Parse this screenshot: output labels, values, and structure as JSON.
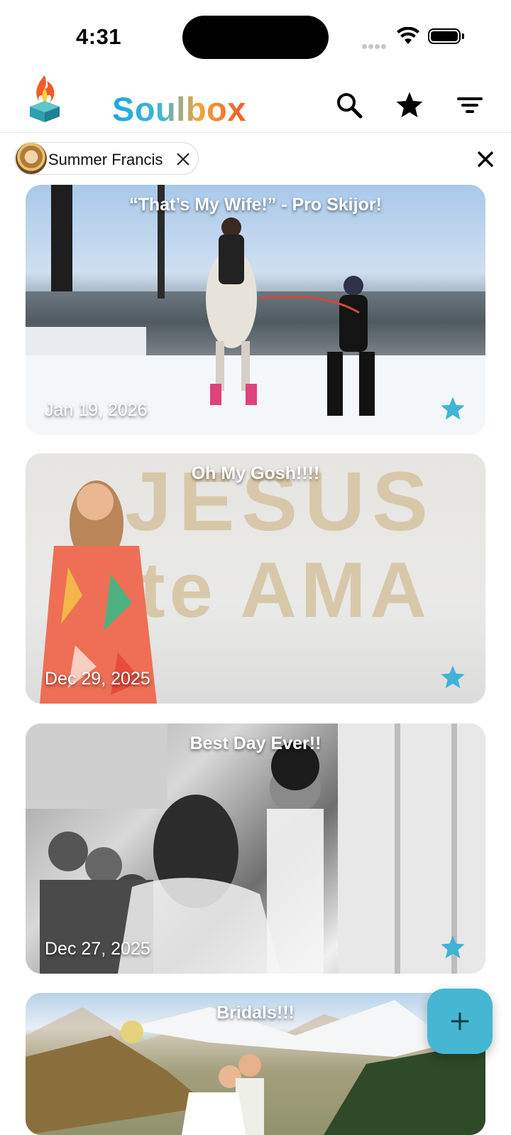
{
  "status_bar": {
    "time": "4:31"
  },
  "header": {
    "brand": "Soulbox",
    "icons": [
      "search-icon",
      "star-icon",
      "filter-icon"
    ]
  },
  "filter": {
    "person_name": "Summer Francis",
    "clear_icon": "close-icon"
  },
  "colors": {
    "accent": "#45b7d2",
    "star": "#3fb4d6",
    "brand_blue": "#22a7e0",
    "brand_orange": "#ec5a2a"
  },
  "memories": [
    {
      "title": "“That’s My Wife!” - Pro Skijor!",
      "date": "Jan 19, 2026",
      "starred": true
    },
    {
      "title": "Oh My Gosh!!!!",
      "date": "Dec 29, 2025",
      "starred": true
    },
    {
      "title": "Best Day Ever!!",
      "date": "Dec 27, 2025",
      "starred": true
    },
    {
      "title": "Bridals!!!",
      "date": "",
      "starred": false
    }
  ],
  "card2_wall_text": {
    "line1": "JESUS",
    "line2": "te AMA"
  },
  "fab": {
    "icon": "plus-icon"
  }
}
